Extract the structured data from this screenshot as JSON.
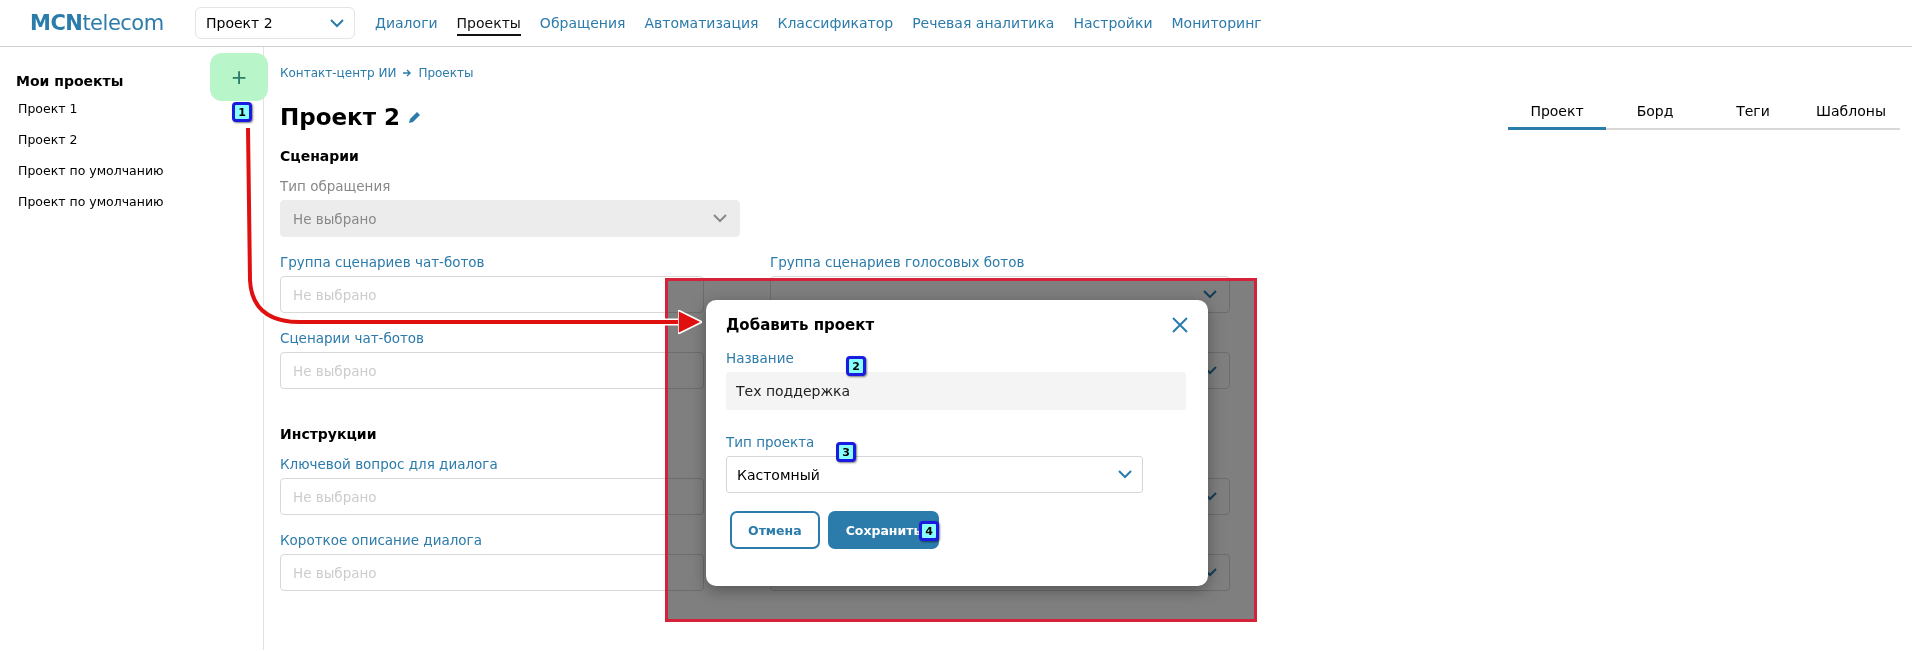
{
  "header": {
    "logo": "**MCN**telecom",
    "project_select": {
      "value": "Проект 2"
    },
    "nav": [
      {
        "label": "Диалоги",
        "selected": false
      },
      {
        "label": "Проекты",
        "selected": true
      },
      {
        "label": "Обращения",
        "selected": false
      },
      {
        "label": "Автоматизация",
        "selected": false
      },
      {
        "label": "Классификатор",
        "selected": false
      },
      {
        "label": "Речевая аналитика",
        "selected": false
      },
      {
        "label": "Настройки",
        "selected": false
      },
      {
        "label": "Мониторинг",
        "selected": false
      }
    ]
  },
  "sidebar": {
    "title": "Мои проекты",
    "add_button": "+",
    "items": [
      "Проект 1",
      "Проект 2",
      "Проект по умолчанию",
      "Проект по умолчанию"
    ]
  },
  "breadcrumb": [
    "Контакт-центр ИИ",
    "Проекты"
  ],
  "page_title": "Проект 2",
  "tabs": [
    {
      "label": "Проект",
      "selected": true
    },
    {
      "label": "Борд",
      "selected": false
    },
    {
      "label": "Теги",
      "selected": false
    },
    {
      "label": "Шаблоны",
      "selected": false
    }
  ],
  "sections": [
    {
      "heading": "Сценарии",
      "rows": [
        [
          {
            "kind": "select",
            "label": "Тип обращения",
            "placeholder": "Не выбрано",
            "disabled": true
          }
        ],
        [
          {
            "kind": "input",
            "label": "Группа сценариев чат-ботов",
            "placeholder": "Не выбрано",
            "disabled": false
          },
          {
            "kind": "select",
            "label": "Группа сценариев голосовых ботов",
            "disabled": false
          }
        ],
        [
          {
            "kind": "input",
            "label": "Сценарии чат-ботов",
            "placeholder": "Не выбрано",
            "disabled": false
          },
          {
            "kind": "select",
            "disabled": false
          }
        ]
      ]
    },
    {
      "heading": "Инструкции",
      "rows": [
        [
          {
            "kind": "input",
            "label": "Ключевой вопрос для диалога",
            "placeholder": "Не выбрано",
            "disabled": false
          },
          {
            "kind": "select",
            "disabled": false
          }
        ],
        [
          {
            "kind": "input",
            "label": "Короткое описание диалога",
            "placeholder": "Не выбрано",
            "disabled": false
          },
          {
            "kind": "select",
            "disabled": false
          }
        ]
      ]
    }
  ],
  "dialog": {
    "title": "Добавить проект",
    "name_label": "Название",
    "name_value": "Тех поддержка",
    "type_label": "Тип проекта",
    "type_value": "Кастомный",
    "buttons": [
      {
        "label": "Отмена",
        "kind": "secondary"
      },
      {
        "label": "Сохранить",
        "kind": "primary"
      }
    ]
  },
  "annotations": [
    {
      "label": "1"
    },
    {
      "label": "2"
    },
    {
      "label": "3"
    },
    {
      "label": "4"
    }
  ]
}
